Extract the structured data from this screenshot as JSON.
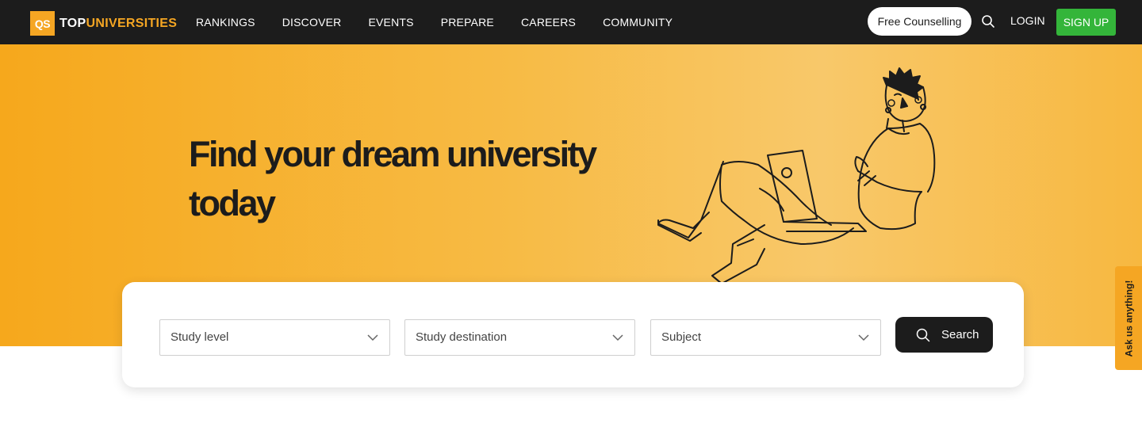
{
  "logo": {
    "badge": "QS",
    "top": "TOP",
    "universities": "UNIVERSITIES"
  },
  "nav": {
    "items": [
      {
        "label": "RANKINGS"
      },
      {
        "label": "DISCOVER"
      },
      {
        "label": "EVENTS"
      },
      {
        "label": "PREPARE"
      },
      {
        "label": "CAREERS"
      },
      {
        "label": "COMMUNITY"
      }
    ],
    "counselling_label": "Free Counselling",
    "search_icon": "search-icon",
    "login_label": "LOGIN",
    "signup_label": "SIGN UP"
  },
  "hero": {
    "title": "Find your dream university today",
    "illustration": "person-with-laptop-illustration"
  },
  "ask_tab": {
    "label": "Ask us anything!"
  },
  "search": {
    "study_level": "Study level",
    "study_destination": "Study destination",
    "subject": "Subject",
    "button_label": "Search"
  },
  "colors": {
    "nav_bg": "#1c1c1c",
    "accent": "#f5a623",
    "signup_green": "#34b53a",
    "hero_orange": "#f6a81c"
  }
}
